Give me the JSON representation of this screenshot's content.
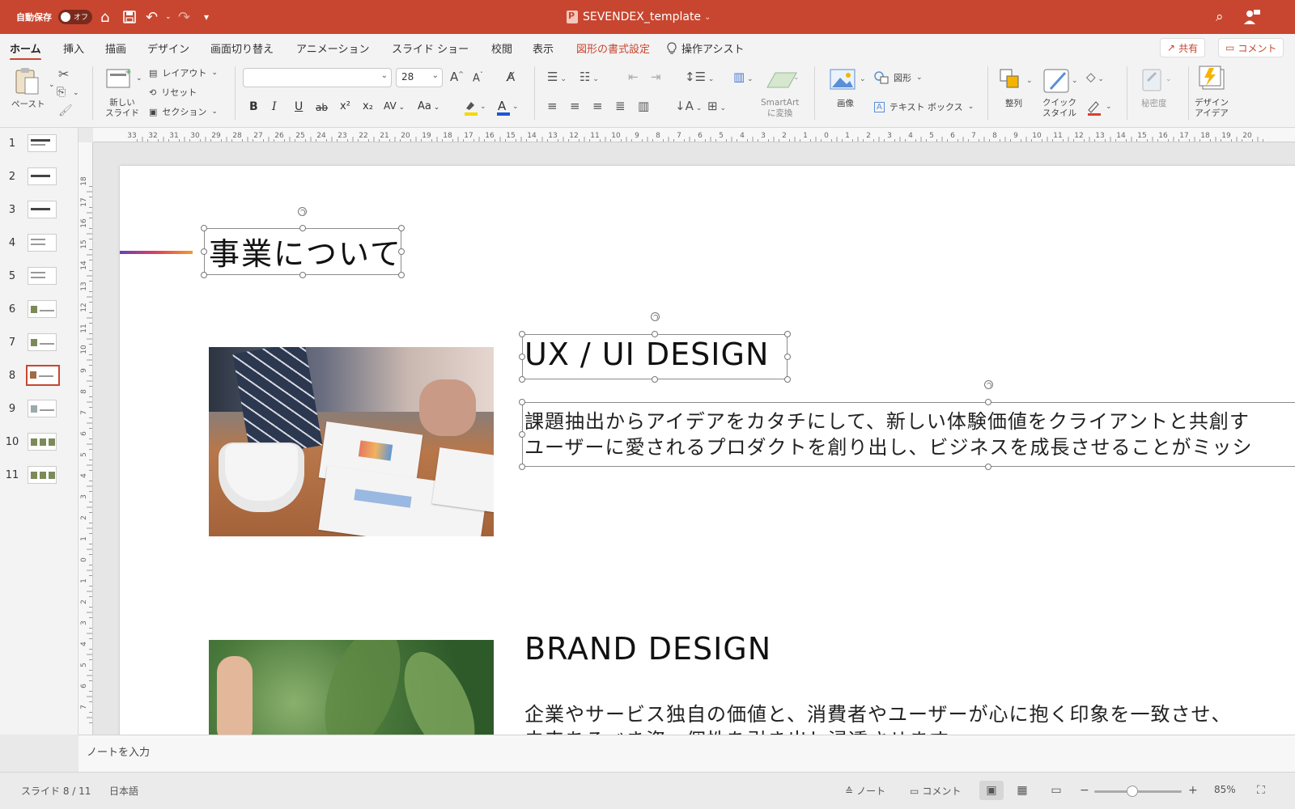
{
  "titlebar": {
    "autosave_label": "自動保存",
    "autosave_state": "オフ",
    "document_title": "SEVENDEX_template"
  },
  "tabs": [
    {
      "label": "ホーム",
      "active": true
    },
    {
      "label": "挿入"
    },
    {
      "label": "描画"
    },
    {
      "label": "デザイン"
    },
    {
      "label": "画面切り替え"
    },
    {
      "label": "アニメーション"
    },
    {
      "label": "スライド ショー"
    },
    {
      "label": "校閲"
    },
    {
      "label": "表示"
    },
    {
      "label": "図形の書式設定",
      "contextual": true
    },
    {
      "label": "操作アシスト"
    }
  ],
  "share_button": "共有",
  "comment_button": "コメント",
  "ribbon": {
    "paste": "ペースト",
    "new_slide_line1": "新しい",
    "new_slide_line2": "スライド",
    "layout": "レイアウト",
    "reset": "リセット",
    "section": "セクション",
    "font_name": "",
    "font_size": "28",
    "smartart_line1": "SmartArt",
    "smartart_line2": "に変換",
    "picture": "画像",
    "shapes": "図形",
    "textbox": "テキスト ボックス",
    "arrange": "整列",
    "quick_style_line1": "クイック",
    "quick_style_line2": "スタイル",
    "sensitivity": "秘密度",
    "designer_line1": "デザイン",
    "designer_line2": "アイデア",
    "bold": "B",
    "italic": "I",
    "underline": "U",
    "strike": "ab",
    "superscript": "x²",
    "subscript": "x₂",
    "char_spacing": "AV",
    "change_case": "Aa"
  },
  "thumbnails": [
    "1",
    "2",
    "3",
    "4",
    "5",
    "6",
    "7",
    "8",
    "9",
    "10",
    "11"
  ],
  "selected_slide": 8,
  "slide": {
    "title": "事業について",
    "section1_heading": "UX / UI DESIGN",
    "section1_line1": "課題抽出からアイデアをカタチにして、新しい体験価値をクライアントと共創す",
    "section1_line2": "ユーザーに愛されるプロダクトを創り出し、ビジネスを成長させることがミッシ",
    "section2_heading": "BRAND DESIGN",
    "section2_line1": "企業やサービス独自の価値と、消費者やユーザーが心に抱く印象を一致させ、",
    "section2_line2": "未来あるべき姿、個性を引き出し浸透させます"
  },
  "notes_placeholder": "ノートを入力",
  "status": {
    "slide_position": "スライド 8 / 11",
    "language": "日本語",
    "notes": "ノート",
    "comments": "コメント",
    "zoom": "85%"
  },
  "ruler_h": [
    "33",
    "32",
    "31",
    "30",
    "29",
    "28",
    "27",
    "26",
    "25",
    "24",
    "23",
    "22",
    "21",
    "20",
    "19",
    "18",
    "17",
    "16",
    "15",
    "14",
    "13",
    "12",
    "11",
    "10",
    "9",
    "8",
    "7",
    "6",
    "5",
    "4",
    "3",
    "2",
    "1",
    "0",
    "1",
    "2",
    "3",
    "4",
    "5",
    "6",
    "7",
    "8",
    "9",
    "10",
    "11",
    "12",
    "13",
    "14",
    "15",
    "16",
    "17",
    "18",
    "19",
    "20"
  ],
  "ruler_v": [
    "18",
    "17",
    "16",
    "15",
    "14",
    "13",
    "12",
    "11",
    "10",
    "9",
    "8",
    "7",
    "6",
    "5",
    "4",
    "3",
    "2",
    "1",
    "0",
    "1",
    "2",
    "3",
    "4",
    "5",
    "6",
    "7"
  ],
  "colors": {
    "accent": "#c8462f",
    "highlight": "#f5d800",
    "font_color": "#1d56d8",
    "line_color": "#e23c2a"
  }
}
